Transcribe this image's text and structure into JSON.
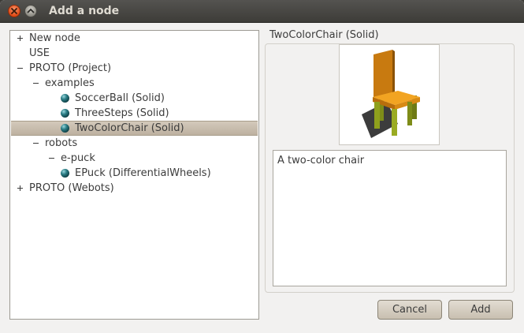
{
  "window": {
    "title": "Add a node",
    "close_icon": "close-icon",
    "minimize_icon": "minimize-icon"
  },
  "tree": {
    "rows": [
      {
        "label": "New node",
        "expander": "plus"
      },
      {
        "label": "USE",
        "expander": "none"
      },
      {
        "label": "PROTO (Project)",
        "expander": "minus"
      },
      {
        "label": "examples",
        "expander": "minus"
      },
      {
        "label": "SoccerBall (Solid)",
        "icon": "sphere-icon"
      },
      {
        "label": "ThreeSteps (Solid)",
        "icon": "sphere-icon"
      },
      {
        "label": "TwoColorChair (Solid)",
        "icon": "sphere-icon",
        "selected": true
      },
      {
        "label": "robots",
        "expander": "minus"
      },
      {
        "label": "e-puck",
        "expander": "minus"
      },
      {
        "label": "EPuck (DifferentialWheels)",
        "icon": "sphere-icon"
      },
      {
        "label": "PROTO (Webots)",
        "expander": "plus"
      }
    ]
  },
  "details": {
    "title": "TwoColorChair (Solid)",
    "preview_icon": "chair-preview",
    "description": "A two-color chair"
  },
  "buttons": {
    "cancel": "Cancel",
    "add": "Add"
  },
  "colors": {
    "chair_seat": "#f0a020",
    "chair_legs": "#8a9a1a",
    "selection": "#c9bfb0"
  }
}
